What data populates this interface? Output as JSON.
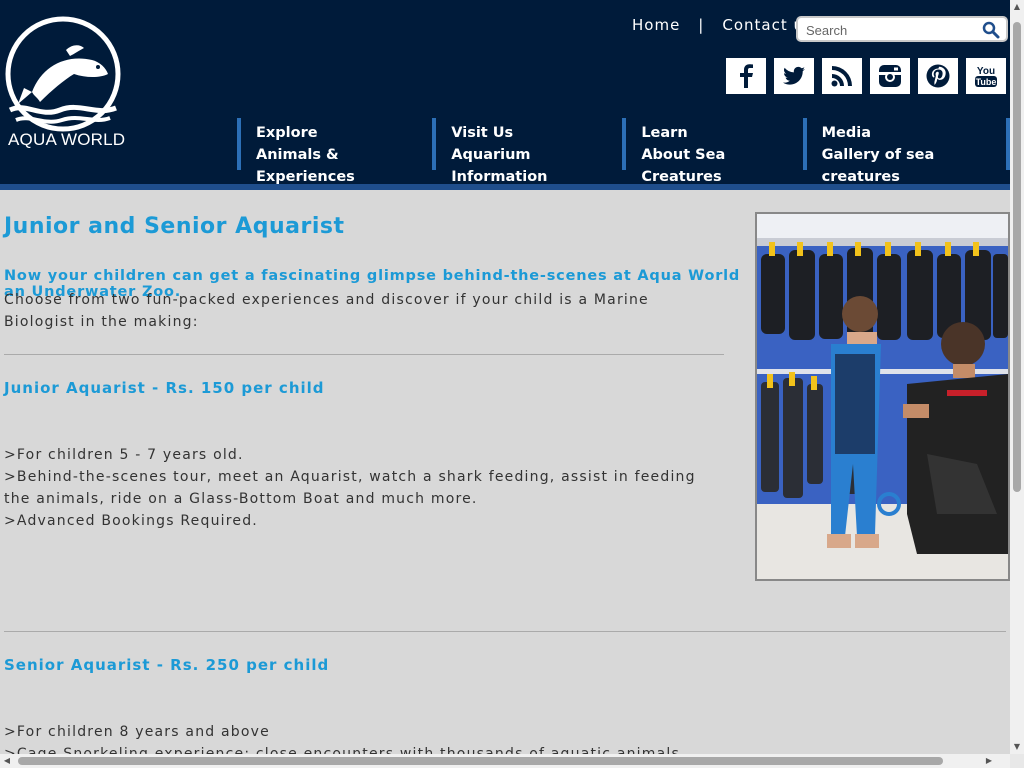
{
  "brand": {
    "name": "AQUA WORLD"
  },
  "top_links": {
    "home": "Home",
    "separator": "|",
    "contact": "Contact us"
  },
  "search": {
    "placeholder": "Search"
  },
  "social": [
    {
      "icon": "facebook-icon",
      "glyph": "f"
    },
    {
      "icon": "twitter-icon",
      "glyph": ""
    },
    {
      "icon": "rss-icon",
      "glyph": ""
    },
    {
      "icon": "instagram-icon",
      "glyph": ""
    },
    {
      "icon": "pinterest-icon",
      "glyph": "p"
    },
    {
      "icon": "youtube-icon",
      "glyph": "You\nTube"
    }
  ],
  "nav": [
    {
      "line1": "Explore",
      "line2": "Animals & Experiences"
    },
    {
      "line1": "Visit Us",
      "line2": "Aquarium Information"
    },
    {
      "line1": "Learn",
      "line2": "About Sea Creatures"
    },
    {
      "line1": "Media",
      "line2": "Gallery of sea creatures"
    }
  ],
  "content": {
    "title": "Junior and Senior Aquarist",
    "lead": "Now your children can get a fascinating glimpse behind-the-scenes at Aqua World an Underwater Zoo.",
    "intro": "Choose from two fun-packed experiences and discover if your child is a Marine Biologist in the making:",
    "junior": {
      "heading": "Junior Aquarist - Rs. 150 per child",
      "items": [
        ">For children 5 - 7 years old.",
        ">Behind-the-scenes tour, meet an Aquarist, watch a shark feeding, assist in feeding the animals, ride on a Glass-Bottom Boat and much more.",
        ">Advanced Bookings Required."
      ]
    },
    "senior": {
      "heading": "Senior Aquarist - Rs. 250 per child",
      "items": [
        ">For children 8 years and above",
        ">Cage Snorkeling experience: close encounters with thousands of aquatic animals"
      ]
    }
  },
  "colors": {
    "header_bg": "#001b3a",
    "accent_blue": "#1c9ad6",
    "nav_divider": "#2c6fb6",
    "page_bg": "#d8d8d8"
  }
}
